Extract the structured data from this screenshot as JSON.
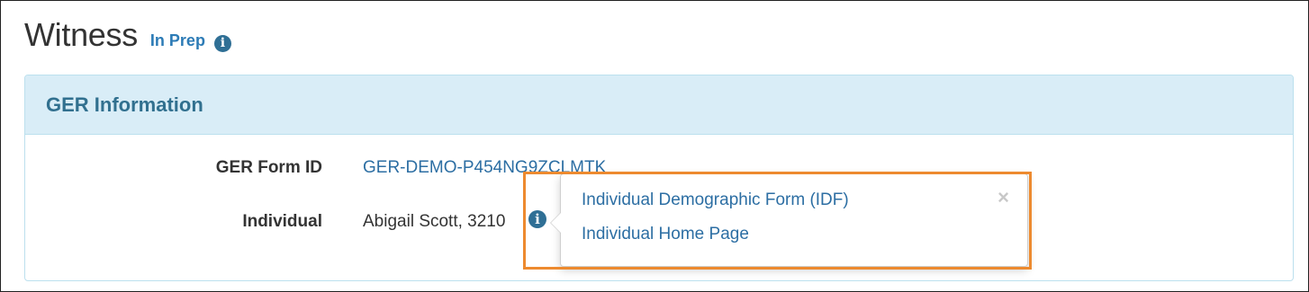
{
  "page": {
    "title": "Witness",
    "status": "In Prep",
    "status_info_icon": "info-icon"
  },
  "panel": {
    "title": "GER Information",
    "fields": {
      "form_id_label": "GER Form ID",
      "form_id_value": "GER-DEMO-P454NG9ZCLMTK",
      "individual_label": "Individual",
      "individual_value": "Abigail Scott, 3210",
      "individual_info_icon": "info-icon"
    }
  },
  "popover": {
    "links": [
      "Individual Demographic Form (IDF)",
      "Individual Home Page"
    ],
    "close_glyph": "×"
  },
  "colors": {
    "link": "#2c6ea3",
    "status": "#2c7bb6",
    "panel_heading_bg": "#d9edf7",
    "panel_title": "#31708f",
    "highlight": "#ed8a2f"
  }
}
